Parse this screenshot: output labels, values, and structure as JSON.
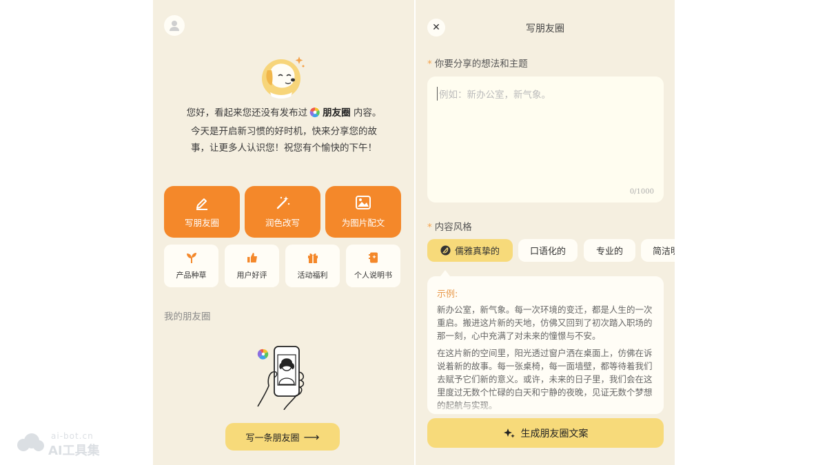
{
  "watermark": {
    "domain": "ai-bot.cn",
    "name": "AI工具集"
  },
  "left": {
    "intro": {
      "part1": "您好，看起来您还没有发布过",
      "brand": "朋友圈",
      "part2": "内容。今天是开启新习惯的好时机，快来分享您的故事，让更多人认识您！祝您有个愉快的下午！"
    },
    "main_actions": [
      {
        "label": "写朋友圈",
        "icon": "pen-icon"
      },
      {
        "label": "润色改写",
        "icon": "magic-wand-icon"
      },
      {
        "label": "为图片配文",
        "icon": "image-icon"
      }
    ],
    "quick_actions": [
      {
        "label": "产品种草",
        "icon": "sprout-icon"
      },
      {
        "label": "用户好评",
        "icon": "thumbs-up-icon"
      },
      {
        "label": "活动福利",
        "icon": "gift-icon"
      },
      {
        "label": "个人说明书",
        "icon": "book-icon"
      }
    ],
    "section_title": "我的朋友圈",
    "write_button": "写一条朋友圈"
  },
  "right": {
    "title": "写朋友圈",
    "topic_label": "你要分享的想法和主题",
    "topic_placeholder": "例如：新办公室，新气象。",
    "char_count": "0/1000",
    "style_label": "内容风格",
    "styles": [
      {
        "label": "儒雅真挚的",
        "active": true
      },
      {
        "label": "口语化的",
        "active": false
      },
      {
        "label": "专业的",
        "active": false
      },
      {
        "label": "简洁明",
        "active": false
      }
    ],
    "example_label": "示例:",
    "example_paragraphs": [
      "新办公室，新气象。每一次环境的变迁，都是人生的一次重启。搬进这片新的天地，仿佛又回到了初次踏入职场的那一刻，心中充满了对未来的憧憬与不安。",
      "在这片新的空间里，阳光透过窗户洒在桌面上，仿佛在诉说着新的故事。每一张桌椅，每一面墙壁，都等待着我们去赋予它们新的意义。或许，未来的日子里，我们会在这里度过无数个忙碌的白天和宁静的夜晚，见证无数个梦想的起航与实现。"
    ],
    "generate_button": "生成朋友圈文案"
  },
  "colors": {
    "panel_bg": "#f5efe0",
    "accent_orange": "#f4882a",
    "accent_yellow": "#f7da7a",
    "card_bg": "#fffdf6"
  }
}
